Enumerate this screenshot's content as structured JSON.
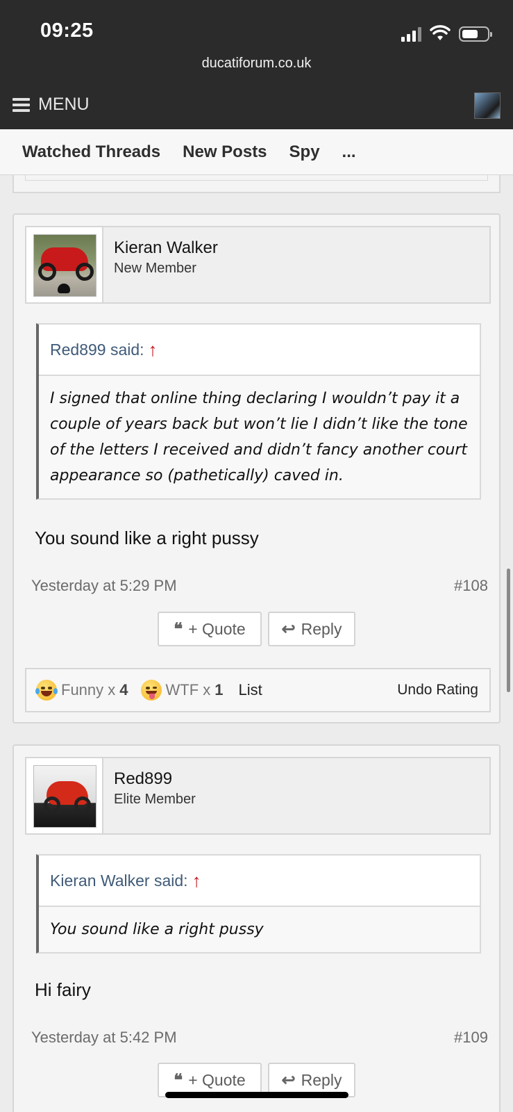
{
  "status_bar": {
    "time": "09:25",
    "domain": "ducatiforum.co.uk"
  },
  "header": {
    "menu_label": "MENU"
  },
  "tabs": [
    {
      "label": "Watched Threads"
    },
    {
      "label": "New Posts"
    },
    {
      "label": "Spy"
    },
    {
      "label": "..."
    }
  ],
  "posts": [
    {
      "username": "Kieran Walker",
      "user_title": "New Member",
      "quote_author": "Red899 said:",
      "quote_text": "I signed that online thing declaring I wouldn’t pay it a couple of years back but won’t lie I didn’t like the tone of the letters I received and didn’t fancy another court appearance so (pathetically) caved in.",
      "message": "You sound like a right pussy",
      "date": "Yesterday at 5:29 PM",
      "number": "#108",
      "quote_button": "+ Quote",
      "reply_button": "Reply",
      "ratings": [
        {
          "label": "Funny x",
          "count": "4"
        },
        {
          "label": "WTF x",
          "count": "1"
        }
      ],
      "list_label": "List",
      "undo_label": "Undo Rating"
    },
    {
      "username": "Red899",
      "user_title": "Elite Member",
      "quote_author": "Kieran Walker said:",
      "quote_text": "You sound like a right pussy",
      "message": "Hi fairy",
      "date": "Yesterday at 5:42 PM",
      "number": "#109",
      "quote_button": "+ Quote",
      "reply_button": "Reply"
    }
  ],
  "icons": {
    "quote_arrow": "↑",
    "quote_glyph": "❝",
    "reply_glyph": "↩"
  },
  "colors": {
    "topbar": "#2b2b2b",
    "quote_author": "#3f5a78",
    "quote_arrow": "#c0151b"
  }
}
